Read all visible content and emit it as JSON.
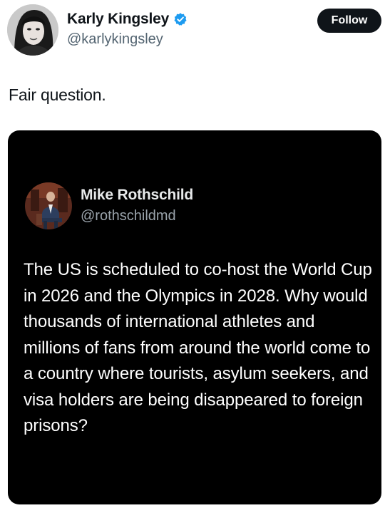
{
  "post": {
    "author": {
      "display_name": "Karly Kingsley",
      "handle": "@karlykingsley",
      "verified": true
    },
    "follow_label": "Follow",
    "text": "Fair question."
  },
  "quoted_post": {
    "author": {
      "display_name": "Mike Rothschild",
      "handle": "@rothschildmd"
    },
    "text": "The US is scheduled to co-host the World Cup in 2026 and the Olympics in 2028. Why would thousands of international athletes and millions of fans from around the world come to a country where tourists, asylum seekers, and visa holders are being disappeared to foreign prisons?"
  },
  "colors": {
    "verified_badge": "#1d9bf0",
    "quote_background": "#000000",
    "follow_button": "#0f1419"
  },
  "icons": {
    "verified": "verified-badge-icon"
  }
}
